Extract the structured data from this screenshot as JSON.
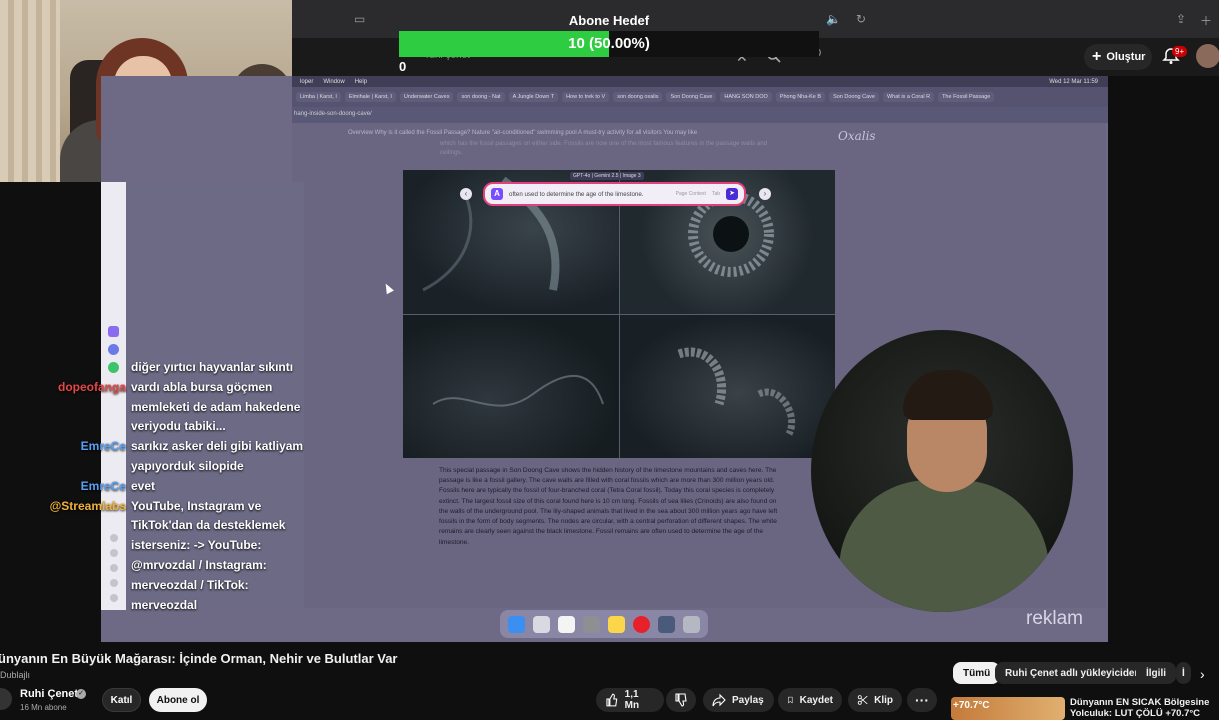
{
  "stream_overlay": {
    "goal_title": "Abone Hedef",
    "goal_value_label": "10 (50.00%)",
    "goal_fraction": 0.5,
    "goal_start": "0"
  },
  "youtube_header": {
    "search_ghost": "ruhi çenet",
    "notification_badge": "9+",
    "create_label": "Oluştur",
    "mic_count": "20"
  },
  "mac_menubar": {
    "items": [
      "loper",
      "Window",
      "Help"
    ],
    "clock": "Wed 12 Mar 11:59"
  },
  "browser_tabs": [
    "Limba | Karst, I",
    "Elmihale | Karst, I",
    "Underwater Caves",
    "son doong - Nat",
    "A Jungle Down T",
    "How to trek to V",
    "son doong oxalis",
    "Son Doong Cave",
    "HANG SON DOO",
    "Phong Nha-Ke B",
    "Son Doong Cave",
    "What is a Coral R",
    "The Fossil Passage"
  ],
  "browser_url": "hang-inside-son-doong-cave/",
  "webpage": {
    "breadcrumb": "Overview   Why is it called the Fossil Passage?   Nature \"air-conditioned\" swimming pool   A must-try activity for all visitors   You may like",
    "logo": "Oxalis",
    "intro_text": "which has the fossil passages on either side. Fossils are now one of the most famous features in the passage walls and ceilings.",
    "zoom_badge": "GPT-4o | Gemini 2.5 | Image 3",
    "ai_query": "often used to determine the age of the limestone.",
    "ai_hint": "Page Context",
    "ai_hint_key": "Tab",
    "body_text": "This special passage in Son Doong Cave shows the hidden history of the limestone mountains and caves here. The passage is like a fossil gallery. The cave walls are filled with coral fossils which are more than 300 million years old. Fossils here are typically the fossil of four-branched coral (Tetra Coral fossil). Today this coral species is completely extinct. The largest fossil size of this coral found here is 10 cm long. Fossils of sea lilies (Crinoids) are also found on the walls of the underground pool. The lily-shaped animals that lived in the sea about 300 million years ago have left fossils in the form of body segments. The nodes are circular, with a central perforation of different shapes. The white remains are clearly seen against the black limestone. Fossil remains are often used to determine the age of the limestone."
  },
  "watermark": "reklam",
  "chat": {
    "lines": [
      {
        "user": "",
        "text": "diğer yırtıcı hayvanlar sıkıntı",
        "color": "#ffffff"
      },
      {
        "user": "dopeofanga",
        "text": "vardı abla bursa göçmen",
        "color": "#e24848"
      },
      {
        "user": "",
        "text": "memleketi de adam hakedene",
        "color": "#ffffff"
      },
      {
        "user": "",
        "text": "veriyodu tabiki...",
        "color": "#ffffff"
      },
      {
        "user": "EmreCe",
        "text": "sarıkız asker deli gibi katliyam",
        "color": "#5aa0f2"
      },
      {
        "user": "",
        "text": "yapıyorduk silopide",
        "color": "#ffffff"
      },
      {
        "user": "EmreCe",
        "text": "evet",
        "color": "#5aa0f2"
      },
      {
        "user": "@Streamlabs",
        "text": "YouTube, Instagram ve",
        "color": "#f0b23a"
      },
      {
        "user": "",
        "text": "TikTok'dan da desteklemek",
        "color": "#ffffff"
      },
      {
        "user": "",
        "text": "isterseniz: -> YouTube:",
        "color": "#ffffff"
      },
      {
        "user": "",
        "text": "@mrvozdal / Instagram:",
        "color": "#ffffff"
      },
      {
        "user": "",
        "text": "merveozdal / TikTok:",
        "color": "#ffffff"
      },
      {
        "user": "",
        "text": "merveozdal",
        "color": "#ffffff"
      }
    ]
  },
  "video": {
    "title": "ünyanın En Büyük Mağarası: İçinde Orman, Nehir ve Bulutlar Var",
    "dub_label": "Dublajlı",
    "channel_name": "Ruhi Çenet",
    "subscribers": "16 Mn abone",
    "join_label": "Katıl",
    "subscribe_label": "Abone ol",
    "likes": "1,1 Mn",
    "share_label": "Paylaş",
    "save_label": "Kaydet",
    "clip_label": "Klip"
  },
  "recommend_chips": [
    "Tümü",
    "Ruhi Çenet adlı yükleyiciden",
    "İlgili",
    "İ"
  ],
  "recommended": {
    "thumb_text": "+70.7°C",
    "title_line1": "Dünyanın EN SICAK Bölgesine",
    "title_line2": "Yolculuk: LUT ÇÖLÜ +70.7°C"
  },
  "colors": {
    "goal_fill": "#2ecc40",
    "yt_bg": "#0f0f0f",
    "badge_red": "#cc0000"
  }
}
